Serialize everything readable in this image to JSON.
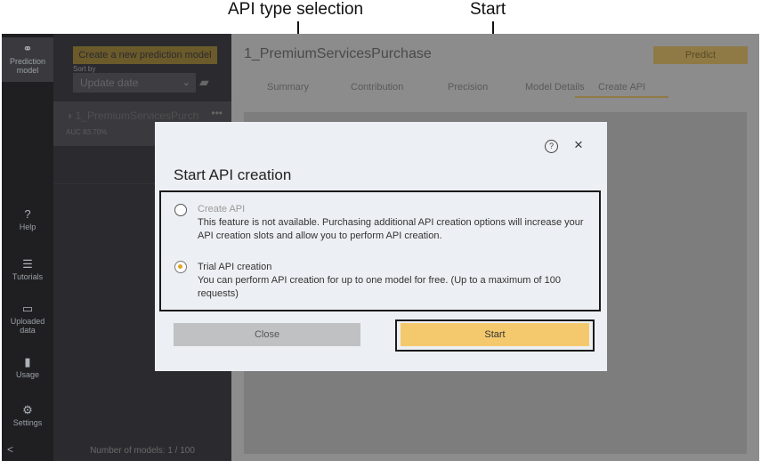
{
  "annotations": {
    "api_type": "API type selection",
    "start": "Start"
  },
  "rail": {
    "items": [
      {
        "label": "Prediction model",
        "icon": "prediction-model-icon"
      },
      {
        "label": "Help",
        "icon": "help-icon"
      },
      {
        "label": "Tutorials",
        "icon": "tutorials-icon"
      },
      {
        "label": "Uploaded data",
        "icon": "folder-icon"
      },
      {
        "label": "Usage",
        "icon": "bar-chart-icon"
      },
      {
        "label": "Settings",
        "icon": "gear-icon"
      }
    ],
    "collapse": "<"
  },
  "list": {
    "create_label": "Create a new prediction model",
    "sort_label": "Sort by",
    "sort_value": "Update date",
    "model": {
      "name": "1_PremiumServicesPurch",
      "auc": "AUC 83.70%"
    },
    "count": "Number of models: 1 / 100"
  },
  "main": {
    "title": "1_PremiumServicesPurchase",
    "predict_label": "Predict",
    "tabs": [
      "Summary",
      "Contribution",
      "Precision",
      "Model Details",
      "Create API"
    ],
    "active_tab": "Create API"
  },
  "modal": {
    "title": "Start API creation",
    "help": "?",
    "close_icon": "×",
    "options": [
      {
        "title": "Create API",
        "desc": "This feature is not available. Purchasing additional API creation options will increase your API creation slots and allow you to perform API creation.",
        "selected": false,
        "disabled": true
      },
      {
        "title": "Trial API creation",
        "desc": "You can perform API creation for up to one model for free. (Up to a maximum of 100 requests)",
        "selected": true,
        "disabled": false
      }
    ],
    "close_label": "Close",
    "start_label": "Start"
  }
}
